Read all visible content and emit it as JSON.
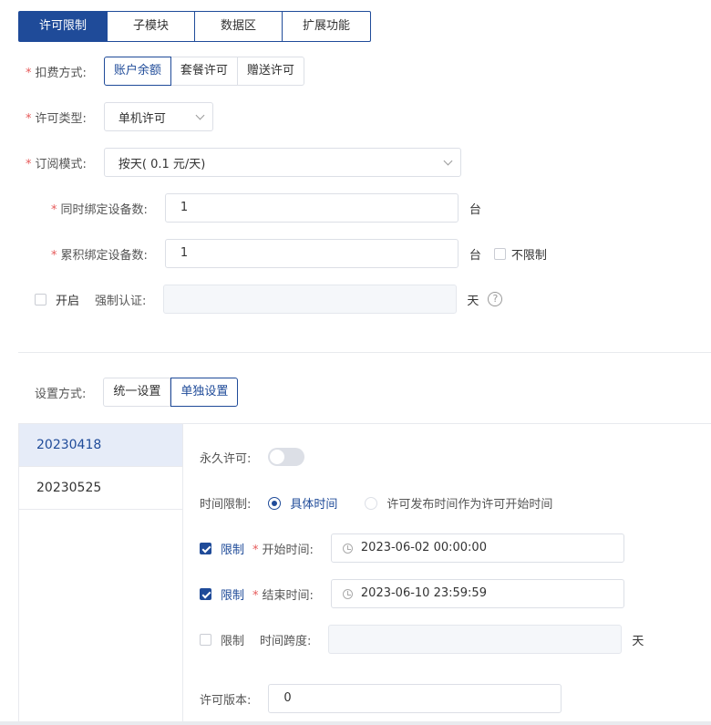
{
  "tabs": [
    {
      "label": "许可限制",
      "active": true
    },
    {
      "label": "子模块",
      "active": false
    },
    {
      "label": "数据区",
      "active": false
    },
    {
      "label": "扩展功能",
      "active": false
    }
  ],
  "billing": {
    "required": "*",
    "label": "扣费方式:",
    "options": [
      "账户余额",
      "套餐许可",
      "赠送许可"
    ]
  },
  "license_type": {
    "required": "*",
    "label": "许可类型:",
    "value": "单机许可"
  },
  "subscription": {
    "required": "*",
    "label": "订阅模式:",
    "value": "按天( 0.1 元/天)"
  },
  "concurrent_devices": {
    "required": "*",
    "label": "同时绑定设备数:",
    "value": "1",
    "unit": "台"
  },
  "total_devices": {
    "required": "*",
    "label": "累积绑定设备数:",
    "value": "1",
    "unit": "台",
    "unlimited_label": "不限制"
  },
  "forced_auth": {
    "enable_label": "开启",
    "label": "强制认证:",
    "value": "",
    "unit": "天",
    "help": "?"
  },
  "setting_mode": {
    "label": "设置方式:",
    "options": [
      "统一设置",
      "单独设置"
    ]
  },
  "versions": [
    {
      "label": "20230418",
      "active": true
    },
    {
      "label": "20230525",
      "active": false
    }
  ],
  "detail": {
    "permanent_label": "永久许可:",
    "time_limit_label": "时间限制:",
    "time_limit_options": [
      "具体时间",
      "许可发布时间作为许可开始时间"
    ],
    "start": {
      "limit_label": "限制",
      "required": "*",
      "label": "开始时间:",
      "value": "2023-06-02 00:00:00"
    },
    "end": {
      "limit_label": "限制",
      "required": "*",
      "label": "结束时间:",
      "value": "2023-06-10 23:59:59"
    },
    "span": {
      "limit_label": "限制",
      "label": "时间跨度:",
      "value": "",
      "unit": "天"
    },
    "version": {
      "label": "许可版本:",
      "value": "0"
    }
  },
  "colors": {
    "primary": "#1f4b99",
    "required": "#e65a5a",
    "border": "#dcdfe6"
  }
}
